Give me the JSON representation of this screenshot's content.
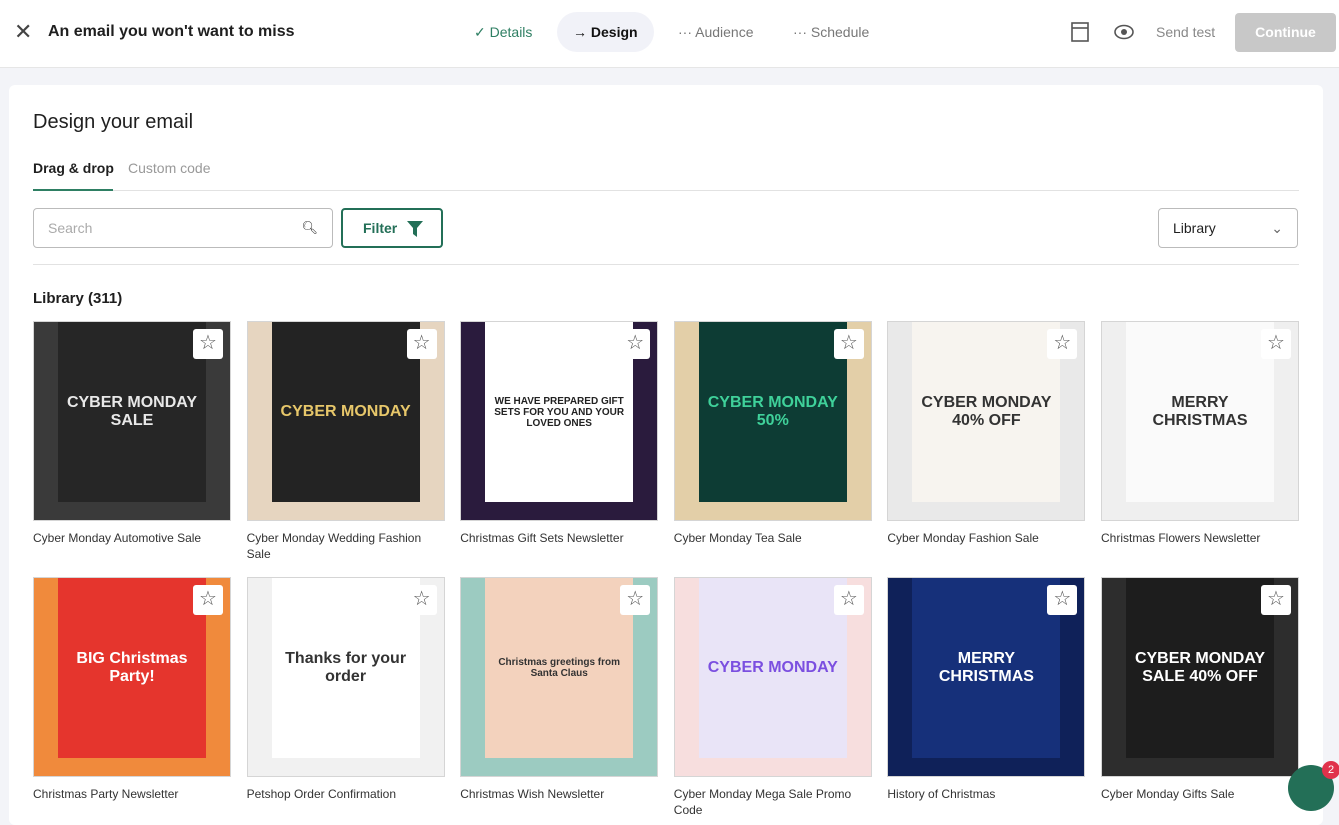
{
  "header": {
    "title": "An email you won't want to miss",
    "steps": [
      {
        "label": "Details",
        "state": "done",
        "icon": "check-icon"
      },
      {
        "label": "Design",
        "state": "active",
        "icon": "arrow-right-icon"
      },
      {
        "label": "Audience",
        "state": "pending",
        "icon": "ellipsis-icon"
      },
      {
        "label": "Schedule",
        "state": "pending",
        "icon": "ellipsis-icon"
      }
    ],
    "send_test": "Send test",
    "continue": "Continue"
  },
  "main": {
    "title": "Design your email",
    "tabs": [
      "Drag & drop",
      "Custom code"
    ],
    "search_placeholder": "Search",
    "filter_label": "Filter",
    "source_select": "Library",
    "library_title": "Library (311)"
  },
  "templates": [
    {
      "name": "Cyber Monday Automotive Sale",
      "thumb_text": "CYBER MONDAY SALE",
      "bg": "#3a3a3a",
      "inner": "#262626",
      "fg": "#e8e8e8"
    },
    {
      "name": "Cyber Monday Wedding Fashion Sale",
      "thumb_text": "CYBER MONDAY",
      "bg": "#e6d5c0",
      "inner": "#232323",
      "fg": "#e7c76a"
    },
    {
      "name": "Christmas Gift Sets Newsletter",
      "thumb_text": "WE HAVE PREPARED GIFT SETS FOR YOU AND YOUR LOVED ONES",
      "bg": "#2a1b3d",
      "inner": "#ffffff",
      "fg": "#222"
    },
    {
      "name": "Cyber Monday Tea Sale",
      "thumb_text": "CYBER MONDAY 50%",
      "bg": "#e3cfa8",
      "inner": "#0d3c34",
      "fg": "#3fd19a"
    },
    {
      "name": "Cyber Monday Fashion Sale",
      "thumb_text": "CYBER MONDAY 40% OFF",
      "bg": "#e9e9e9",
      "inner": "#f7f4ef",
      "fg": "#333"
    },
    {
      "name": "Christmas Flowers Newsletter",
      "thumb_text": "MERRY CHRISTMAS",
      "bg": "#efefef",
      "inner": "#fafafa",
      "fg": "#333"
    },
    {
      "name": "Christmas Party Newsletter",
      "thumb_text": "BIG Christmas Party!",
      "bg": "#f08a3c",
      "inner": "#e5352d",
      "fg": "#ffffff"
    },
    {
      "name": "Petshop Order Confirmation",
      "thumb_text": "Thanks for your order",
      "bg": "#f1f1f1",
      "inner": "#ffffff",
      "fg": "#333"
    },
    {
      "name": "Christmas Wish Newsletter",
      "thumb_text": "Christmas greetings from Santa Claus",
      "bg": "#9ccbc1",
      "inner": "#f3d2bd",
      "fg": "#333"
    },
    {
      "name": "Cyber Monday Mega Sale Promo Code",
      "thumb_text": "CYBER MONDAY",
      "bg": "#f7dede",
      "inner": "#e9e4f7",
      "fg": "#7b4fe0"
    },
    {
      "name": "History of Christmas",
      "thumb_text": "MERRY CHRISTMAS",
      "bg": "#0f2159",
      "inner": "#16307a",
      "fg": "#ffffff"
    },
    {
      "name": "Cyber Monday Gifts Sale",
      "thumb_text": "CYBER MONDAY SALE 40% OFF",
      "bg": "#2d2d2d",
      "inner": "#1d1d1d",
      "fg": "#ffffff"
    }
  ],
  "chat": {
    "badge": "2"
  },
  "colors": {
    "accent": "#236f57",
    "done": "#2e7f63"
  }
}
